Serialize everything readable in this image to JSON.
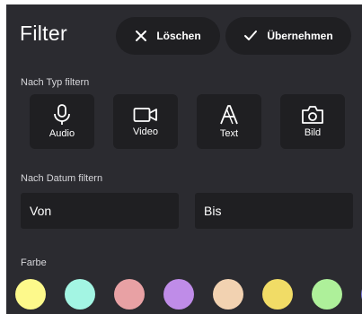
{
  "header": {
    "title": "Filter",
    "clear_label": "Löschen",
    "apply_label": "Übernehmen"
  },
  "type_filter": {
    "label": "Nach Typ filtern",
    "types": [
      {
        "label": "Audio",
        "icon": "microphone-icon"
      },
      {
        "label": "Video",
        "icon": "video-camera-icon"
      },
      {
        "label": "Text",
        "icon": "text-icon"
      },
      {
        "label": "Bild",
        "icon": "photo-camera-icon"
      }
    ]
  },
  "date_filter": {
    "label": "Nach Datum filtern",
    "from_label": "Von",
    "to_label": "Bis"
  },
  "color_filter": {
    "label": "Farbe",
    "colors": [
      "#fdf98b",
      "#a3f5e3",
      "#e8a1a4",
      "#bf8ce8",
      "#f2d2b1",
      "#f1dc66",
      "#aef09a",
      "#7f7fe0"
    ]
  }
}
